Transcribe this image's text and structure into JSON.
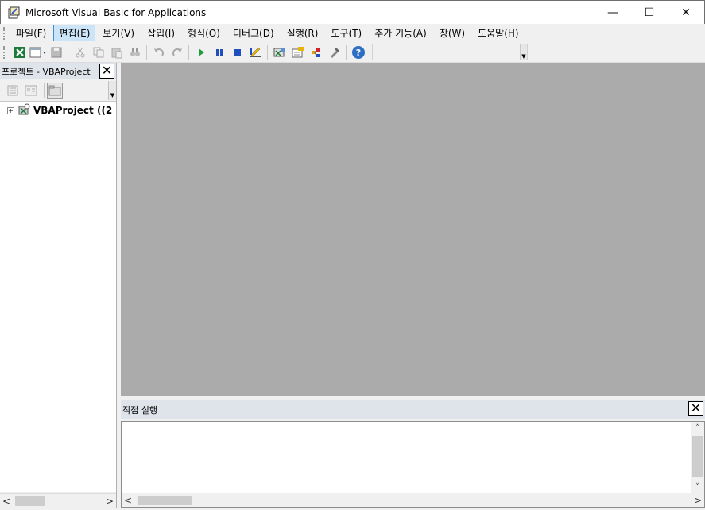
{
  "window": {
    "title": "Microsoft Visual Basic for Applications",
    "minimize_symbol": "—",
    "maximize_symbol": "☐",
    "close_symbol": "✕"
  },
  "menu": [
    {
      "id": "file",
      "label": "파일(F)"
    },
    {
      "id": "edit",
      "label": "편집(E)",
      "active": true
    },
    {
      "id": "view",
      "label": "보기(V)"
    },
    {
      "id": "insert",
      "label": "삽입(I)"
    },
    {
      "id": "format",
      "label": "형식(O)"
    },
    {
      "id": "debug",
      "label": "디버그(D)"
    },
    {
      "id": "run",
      "label": "실행(R)"
    },
    {
      "id": "tools",
      "label": "도구(T)"
    },
    {
      "id": "addins",
      "label": "추가 기능(A)"
    },
    {
      "id": "window",
      "label": "창(W)"
    },
    {
      "id": "help",
      "label": "도움말(H)"
    }
  ],
  "toolbar": {
    "icons": [
      "excel-icon",
      "insert-userform-icon",
      "save-icon",
      "cut-icon",
      "copy-icon",
      "paste-icon",
      "find-icon",
      "undo-icon",
      "redo-icon",
      "run-icon",
      "break-icon",
      "reset-icon",
      "design-mode-icon",
      "project-explorer-icon",
      "properties-icon",
      "object-browser-icon",
      "toolbox-icon",
      "help-icon"
    ],
    "colors": {
      "run": "#1e9b3c",
      "stop": "#1f4fbf",
      "help": "#2d6fc4",
      "excel": "#1d7a3a"
    }
  },
  "project_pane": {
    "title": "프로젝트 - VBAProject",
    "close_symbol": "✕",
    "tree": [
      {
        "label": "VBAProject ((2",
        "expander": "+"
      }
    ]
  },
  "immediate_pane": {
    "title": "직접 실행",
    "close_symbol": "✕"
  },
  "scroll": {
    "left": "<",
    "right": ">",
    "up": "˄",
    "down": "˅"
  }
}
